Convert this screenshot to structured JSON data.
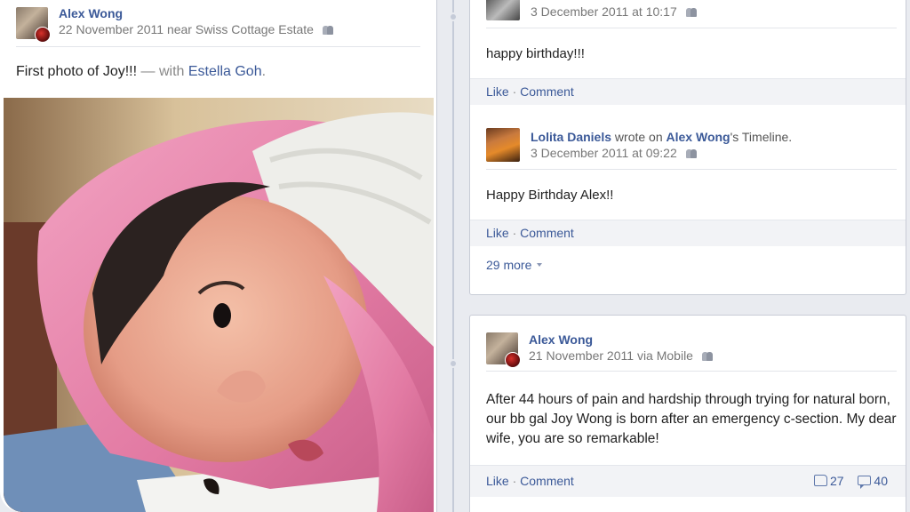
{
  "left_post": {
    "author": "Alex Wong",
    "date": "22 November 2011",
    "location_prefix": "near",
    "location": "Swiss Cottage Estate",
    "text": "First photo of Joy!!!",
    "with_prefix": "— with",
    "tagged": "Estella Goh",
    "tagged_suffix": "."
  },
  "comments": [
    {
      "timestamp": "3 December 2011 at 10:17",
      "text": "happy birthday!!!",
      "like_label": "Like",
      "comment_label": "Comment"
    },
    {
      "author": "Lolita Daniels",
      "wrote_on": "wrote on",
      "target": "Alex Wong",
      "target_suffix": "'s Timeline.",
      "timestamp": "3 December 2011 at 09:22",
      "text": "Happy Birthday Alex!!",
      "like_label": "Like",
      "comment_label": "Comment"
    }
  ],
  "more_label": "29 more",
  "bottom_post": {
    "author": "Alex Wong",
    "date": "21 November 2011",
    "via": "via Mobile",
    "text": "After 44 hours of pain and hardship through trying for natural born, our bb gal Joy Wong is born after an emergency c-section. My dear wife, you are so remarkable!",
    "like_label": "Like",
    "comment_label": "Comment",
    "like_count": "27",
    "comment_count": "40"
  },
  "separator": "·",
  "colors": {
    "link": "#3b5998",
    "background": "#e9ebf0",
    "pink_blanket": "#e27aa3"
  },
  "icons": [
    "friends-privacy-icon",
    "like-icon",
    "comment-icon",
    "dropdown-caret-icon"
  ]
}
